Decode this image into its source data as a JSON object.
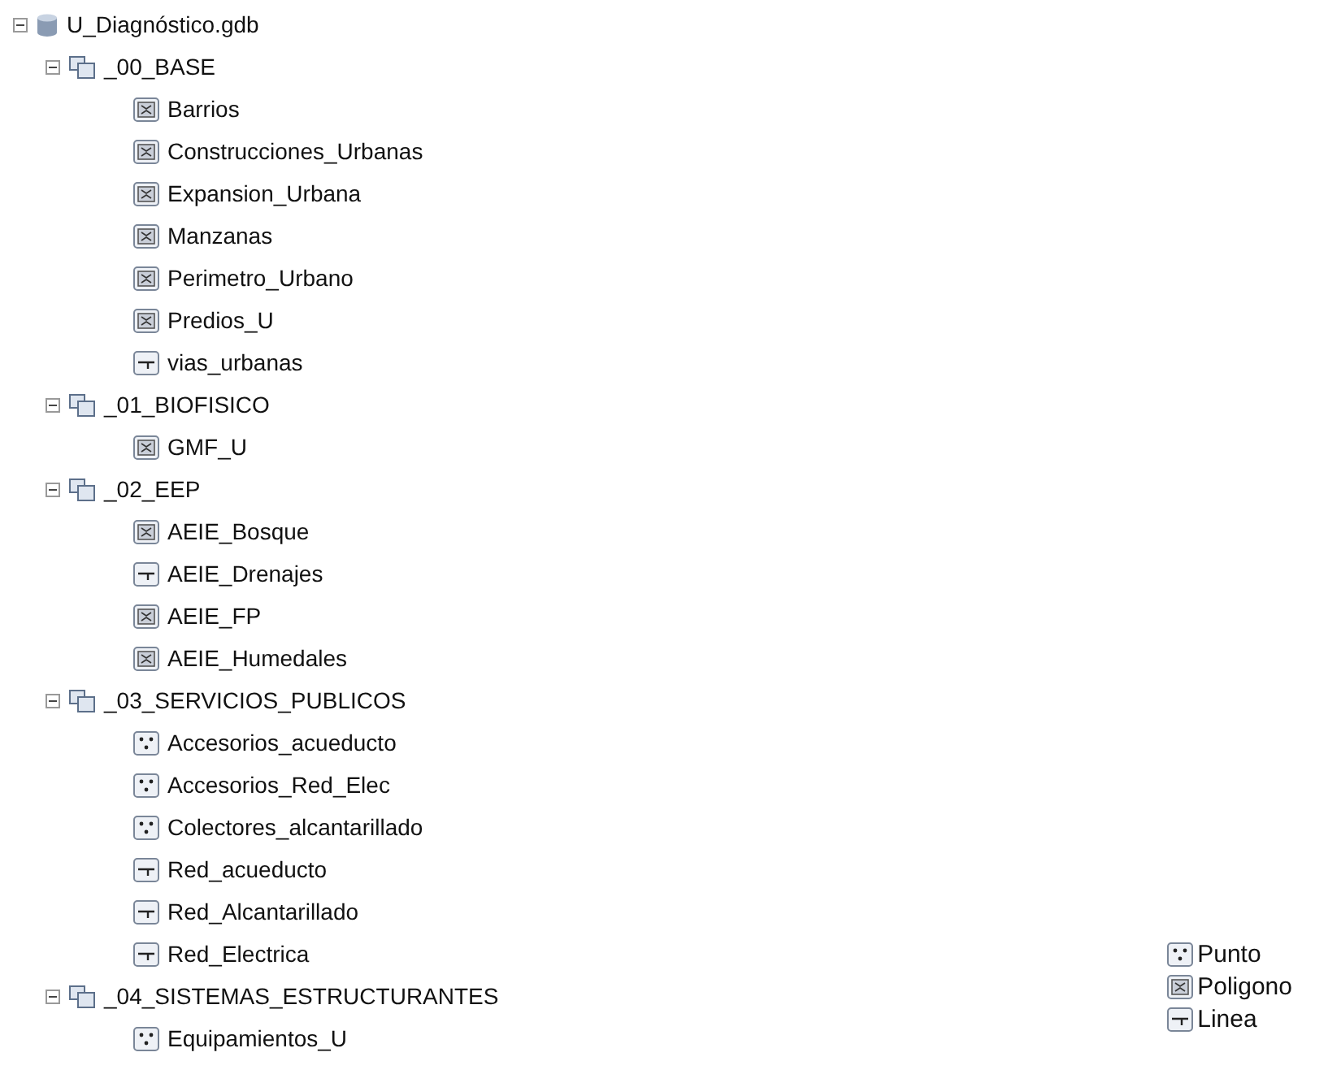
{
  "tree": {
    "name": "U_Diagnóstico.gdb",
    "expanded": true,
    "children": [
      {
        "name": "_00_BASE",
        "expanded": true,
        "children": [
          {
            "name": "Barrios",
            "kind": "polygon"
          },
          {
            "name": "Construcciones_Urbanas",
            "kind": "polygon"
          },
          {
            "name": "Expansion_Urbana",
            "kind": "polygon"
          },
          {
            "name": "Manzanas",
            "kind": "polygon"
          },
          {
            "name": "Perimetro_Urbano",
            "kind": "polygon"
          },
          {
            "name": "Predios_U",
            "kind": "polygon"
          },
          {
            "name": "vias_urbanas",
            "kind": "line"
          }
        ]
      },
      {
        "name": "_01_BIOFISICO",
        "expanded": true,
        "children": [
          {
            "name": "GMF_U",
            "kind": "polygon"
          }
        ]
      },
      {
        "name": "_02_EEP",
        "expanded": true,
        "children": [
          {
            "name": "AEIE_Bosque",
            "kind": "polygon"
          },
          {
            "name": "AEIE_Drenajes",
            "kind": "line"
          },
          {
            "name": "AEIE_FP",
            "kind": "polygon"
          },
          {
            "name": "AEIE_Humedales",
            "kind": "polygon"
          }
        ]
      },
      {
        "name": "_03_SERVICIOS_PUBLICOS",
        "expanded": true,
        "children": [
          {
            "name": "Accesorios_acueducto",
            "kind": "point"
          },
          {
            "name": "Accesorios_Red_Elec",
            "kind": "point"
          },
          {
            "name": "Colectores_alcantarillado",
            "kind": "point"
          },
          {
            "name": "Red_acueducto",
            "kind": "line"
          },
          {
            "name": "Red_Alcantarillado",
            "kind": "line"
          },
          {
            "name": "Red_Electrica",
            "kind": "line"
          }
        ]
      },
      {
        "name": "_04_SISTEMAS_ESTRUCTURANTES",
        "expanded": true,
        "children": [
          {
            "name": "Equipamientos_U",
            "kind": "point"
          }
        ]
      }
    ]
  },
  "legend": [
    {
      "kind": "point",
      "label": "Punto"
    },
    {
      "kind": "polygon",
      "label": "Poligono"
    },
    {
      "kind": "line",
      "label": "Linea"
    }
  ]
}
